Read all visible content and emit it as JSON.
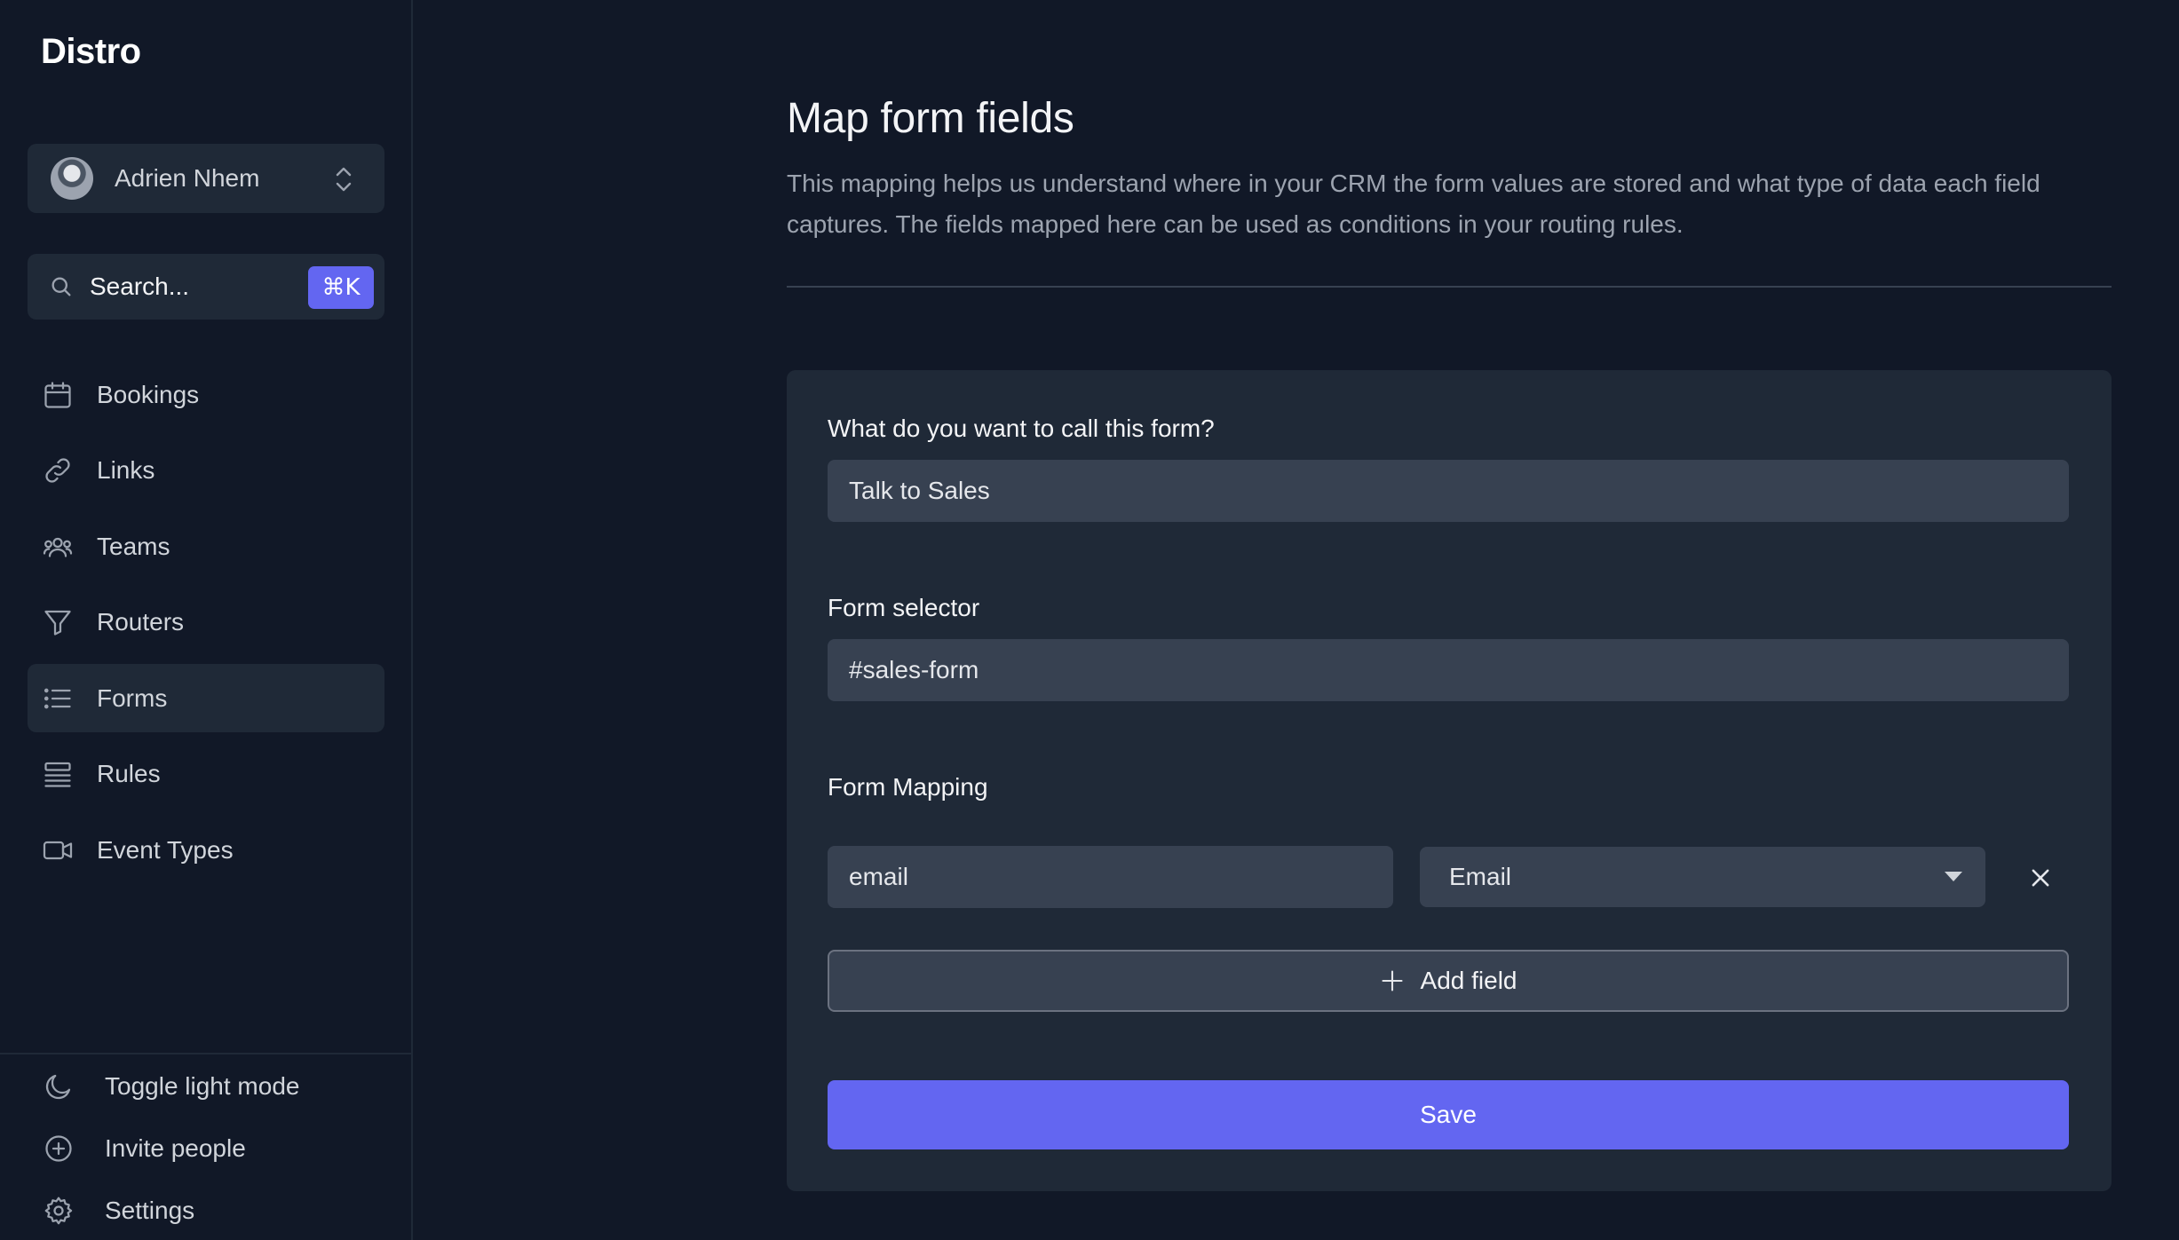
{
  "app": {
    "name": "Distro"
  },
  "user": {
    "name": "Adrien Nhem"
  },
  "search": {
    "placeholder": "Search...",
    "shortcut": "⌘K"
  },
  "nav": {
    "items": [
      {
        "label": "Bookings",
        "icon": "calendar-icon"
      },
      {
        "label": "Links",
        "icon": "link-icon"
      },
      {
        "label": "Teams",
        "icon": "users-icon"
      },
      {
        "label": "Routers",
        "icon": "filter-icon"
      },
      {
        "label": "Forms",
        "icon": "list-icon",
        "active": true
      },
      {
        "label": "Rules",
        "icon": "queue-list-icon"
      },
      {
        "label": "Event Types",
        "icon": "video-camera-icon"
      }
    ]
  },
  "footer": {
    "toggle_theme": "Toggle light mode",
    "invite": "Invite people",
    "settings": "Settings"
  },
  "page": {
    "title": "Map form fields",
    "description": "This mapping helps us understand where in your CRM the form values are stored and what type of data each field captures. The fields mapped here can be used as conditions in your routing rules."
  },
  "form": {
    "name_label": "What do you want to call this form?",
    "name_value": "Talk to Sales",
    "selector_label": "Form selector",
    "selector_value": "#sales-form",
    "mapping_label": "Form Mapping",
    "mappings": [
      {
        "key": "email",
        "type": "Email"
      }
    ],
    "add_field_label": "Add field",
    "save_label": "Save"
  },
  "colors": {
    "background": "#111827",
    "card": "#1f2937",
    "input": "#374151",
    "accent": "#6366f1"
  }
}
